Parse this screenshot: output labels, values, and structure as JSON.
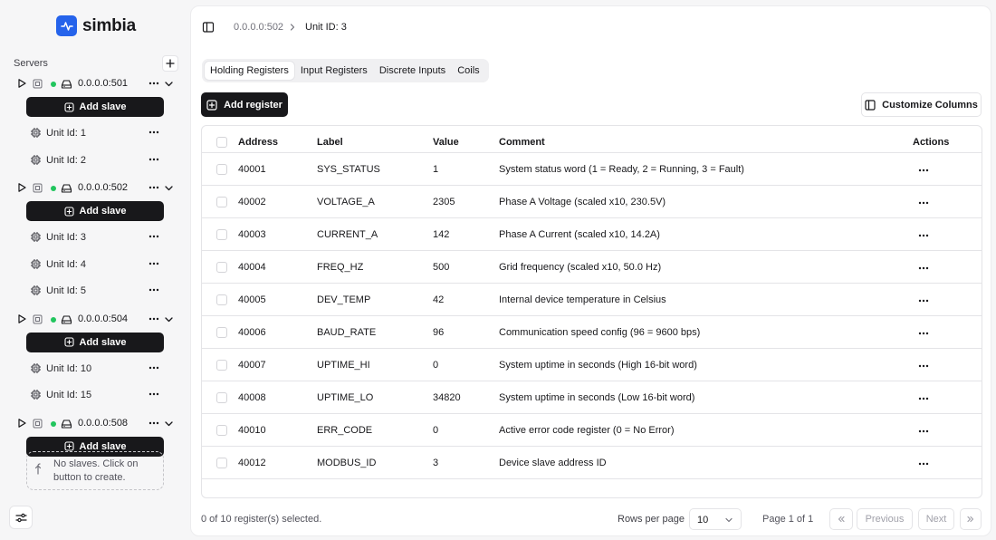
{
  "app": {
    "name": "simbia"
  },
  "sidebar": {
    "servers_label": "Servers",
    "add_slave_label": "Add slave",
    "empty_slaves_text": "No slaves. Click on button to create.",
    "servers": [
      {
        "name": "0.0.0.0:501",
        "status_color": "#22c55e",
        "slaves": [
          "Unit Id: 1",
          "Unit Id: 2"
        ]
      },
      {
        "name": "0.0.0.0:502",
        "status_color": "#22c55e",
        "slaves": [
          "Unit Id: 3",
          "Unit Id: 4",
          "Unit Id: 5"
        ]
      },
      {
        "name": "0.0.0.0:504",
        "status_color": "#22c55e",
        "slaves": [
          "Unit Id: 10",
          "Unit Id: 15"
        ]
      },
      {
        "name": "0.0.0.0:508",
        "status_color": "#22c55e",
        "slaves": []
      }
    ]
  },
  "breadcrumb": {
    "server": "0.0.0.0:502",
    "unit": "Unit ID: 3"
  },
  "tabs": [
    "Holding Registers",
    "Input Registers",
    "Discrete Inputs",
    "Coils"
  ],
  "toolbar": {
    "add_register": "Add register",
    "customize_columns": "Customize Columns"
  },
  "table": {
    "columns": [
      "Address",
      "Label",
      "Value",
      "Comment",
      "Actions"
    ],
    "rows": [
      {
        "address": "40001",
        "label": "SYS_STATUS",
        "value": "1",
        "comment": "System status word (1 = Ready, 2 = Running, 3 = Fault)"
      },
      {
        "address": "40002",
        "label": "VOLTAGE_A",
        "value": "2305",
        "comment": "Phase A Voltage (scaled x10, 230.5V)"
      },
      {
        "address": "40003",
        "label": "CURRENT_A",
        "value": "142",
        "comment": "Phase A Current (scaled x10, 14.2A)"
      },
      {
        "address": "40004",
        "label": "FREQ_HZ",
        "value": "500",
        "comment": "Grid frequency (scaled x10, 50.0 Hz)"
      },
      {
        "address": "40005",
        "label": "DEV_TEMP",
        "value": "42",
        "comment": "Internal device temperature in Celsius"
      },
      {
        "address": "40006",
        "label": "BAUD_RATE",
        "value": "96",
        "comment": "Communication speed config (96 = 9600 bps)"
      },
      {
        "address": "40007",
        "label": "UPTIME_HI",
        "value": "0",
        "comment": "System uptime in seconds (High 16-bit word)"
      },
      {
        "address": "40008",
        "label": "UPTIME_LO",
        "value": "34820",
        "comment": "System uptime in seconds (Low 16-bit word)"
      },
      {
        "address": "40010",
        "label": "ERR_CODE",
        "value": "0",
        "comment": "Active error code register (0 = No Error)"
      },
      {
        "address": "40012",
        "label": "MODBUS_ID",
        "value": "3",
        "comment": "Device slave address ID"
      }
    ]
  },
  "footer": {
    "selection": "0 of 10 register(s) selected.",
    "rows_per_page_label": "Rows per page",
    "rows_per_page_value": "10",
    "page_info": "Page 1 of 1",
    "previous": "Previous",
    "next": "Next"
  },
  "colors": {
    "brand": "#2563eb",
    "primary_button": "#18181b",
    "status_online": "#22c55e"
  }
}
